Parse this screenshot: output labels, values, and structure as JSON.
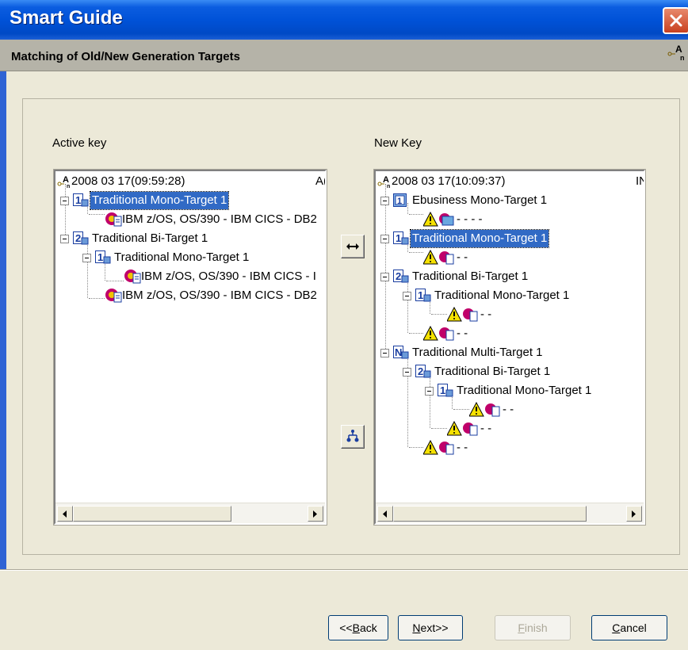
{
  "window": {
    "title": "Smart Guide",
    "subtitle": "Matching of Old/New Generation Targets"
  },
  "left_panel": {
    "label": "Active key",
    "root": {
      "text": "2008 03 17(09:59:28)",
      "suffix": "A("
    },
    "items": [
      {
        "text": "Traditional Mono-Target 1",
        "icon": "mono-target-icon",
        "selected": true
      },
      {
        "text": "IBM z/OS, OS/390 - IBM CICS - DB2",
        "icon": "platform-icon"
      },
      {
        "text": "Traditional Bi-Target 1",
        "icon": "bi-target-icon"
      },
      {
        "text": "Traditional Mono-Target 1",
        "icon": "mono-target-icon"
      },
      {
        "text": "IBM z/OS, OS/390 - IBM CICS - I",
        "icon": "platform-icon"
      },
      {
        "text": "IBM z/OS, OS/390 - IBM CICS - DB2",
        "icon": "platform-icon"
      }
    ]
  },
  "right_panel": {
    "label": "New Key",
    "root": {
      "text": "2008 03 17(10:09:37)",
      "suffix": "IN"
    },
    "items": [
      {
        "text": "Ebusiness Mono-Target 1",
        "icon": "ebusiness-target-icon"
      },
      {
        "text": "- - - -",
        "icon": "warning-platform-icon"
      },
      {
        "text": "Traditional Mono-Target 1",
        "icon": "mono-target-icon",
        "selected": true
      },
      {
        "text": "- -",
        "icon": "warning-platform-icon"
      },
      {
        "text": "Traditional Bi-Target 1",
        "icon": "bi-target-icon"
      },
      {
        "text": "Traditional Mono-Target 1",
        "icon": "mono-target-icon"
      },
      {
        "text": "- -",
        "icon": "warning-platform-icon"
      },
      {
        "text": "- -",
        "icon": "warning-platform-icon"
      },
      {
        "text": "Traditional Multi-Target 1",
        "icon": "multi-target-icon"
      },
      {
        "text": "Traditional Bi-Target 1",
        "icon": "bi-target-icon"
      },
      {
        "text": "Traditional Mono-Target 1",
        "icon": "mono-target-icon"
      },
      {
        "text": "- -",
        "icon": "warning-platform-icon"
      },
      {
        "text": "- -",
        "icon": "warning-platform-icon"
      },
      {
        "text": "- -",
        "icon": "warning-platform-icon"
      }
    ]
  },
  "buttons": {
    "back_prefix": "<<",
    "back_mnemonic": "B",
    "back_rest": "ack",
    "next_mnemonic": "N",
    "next_rest": "ext>>",
    "finish_mnemonic": "F",
    "finish_rest": "inish",
    "cancel_mnemonic": "C",
    "cancel_rest": "ancel"
  },
  "colors": {
    "titlebar": "#0052d8",
    "selection": "#316ac5",
    "window_bg": "#ece9d8"
  }
}
